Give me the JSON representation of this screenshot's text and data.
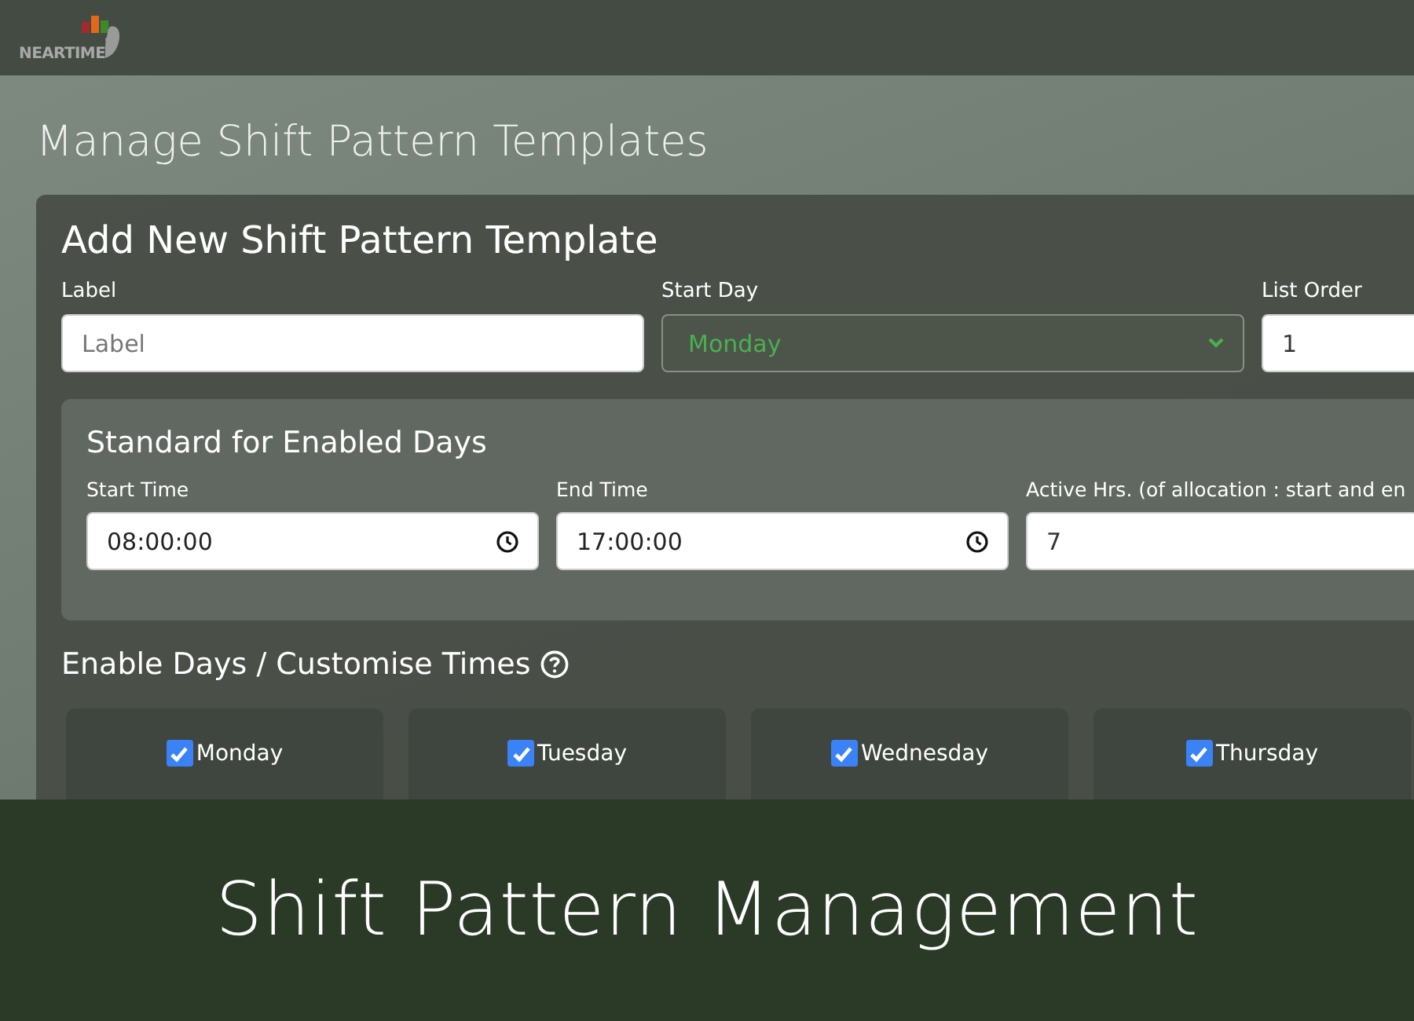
{
  "header": {
    "logo_text": "NEARTIME"
  },
  "page_title": "Manage Shift Pattern Templates",
  "form": {
    "title": "Add New Shift Pattern Template",
    "fields": [
      {
        "label": "Label",
        "kind": "text",
        "placeholder": "Label"
      },
      {
        "label": "Start Day",
        "kind": "select",
        "value": "Monday"
      },
      {
        "label": "List Order",
        "kind": "number",
        "value": "1"
      }
    ]
  },
  "standard": {
    "title": "Standard for Enabled Days",
    "fields": [
      {
        "label": "Start Time",
        "kind": "time",
        "value": "08:00:00"
      },
      {
        "label": "End Time",
        "kind": "time",
        "value": "17:00:00"
      },
      {
        "label": "Active Hrs. (of allocation : start and en",
        "kind": "number",
        "value": "7"
      }
    ]
  },
  "days_section": {
    "title": "Enable Days / Customise Times"
  },
  "days": [
    {
      "name": "Monday",
      "checked": true
    },
    {
      "name": "Tuesday",
      "checked": true
    },
    {
      "name": "Wednesday",
      "checked": true
    },
    {
      "name": "Thursday",
      "checked": true
    }
  ],
  "banner": {
    "title": "Shift Pattern Management"
  }
}
